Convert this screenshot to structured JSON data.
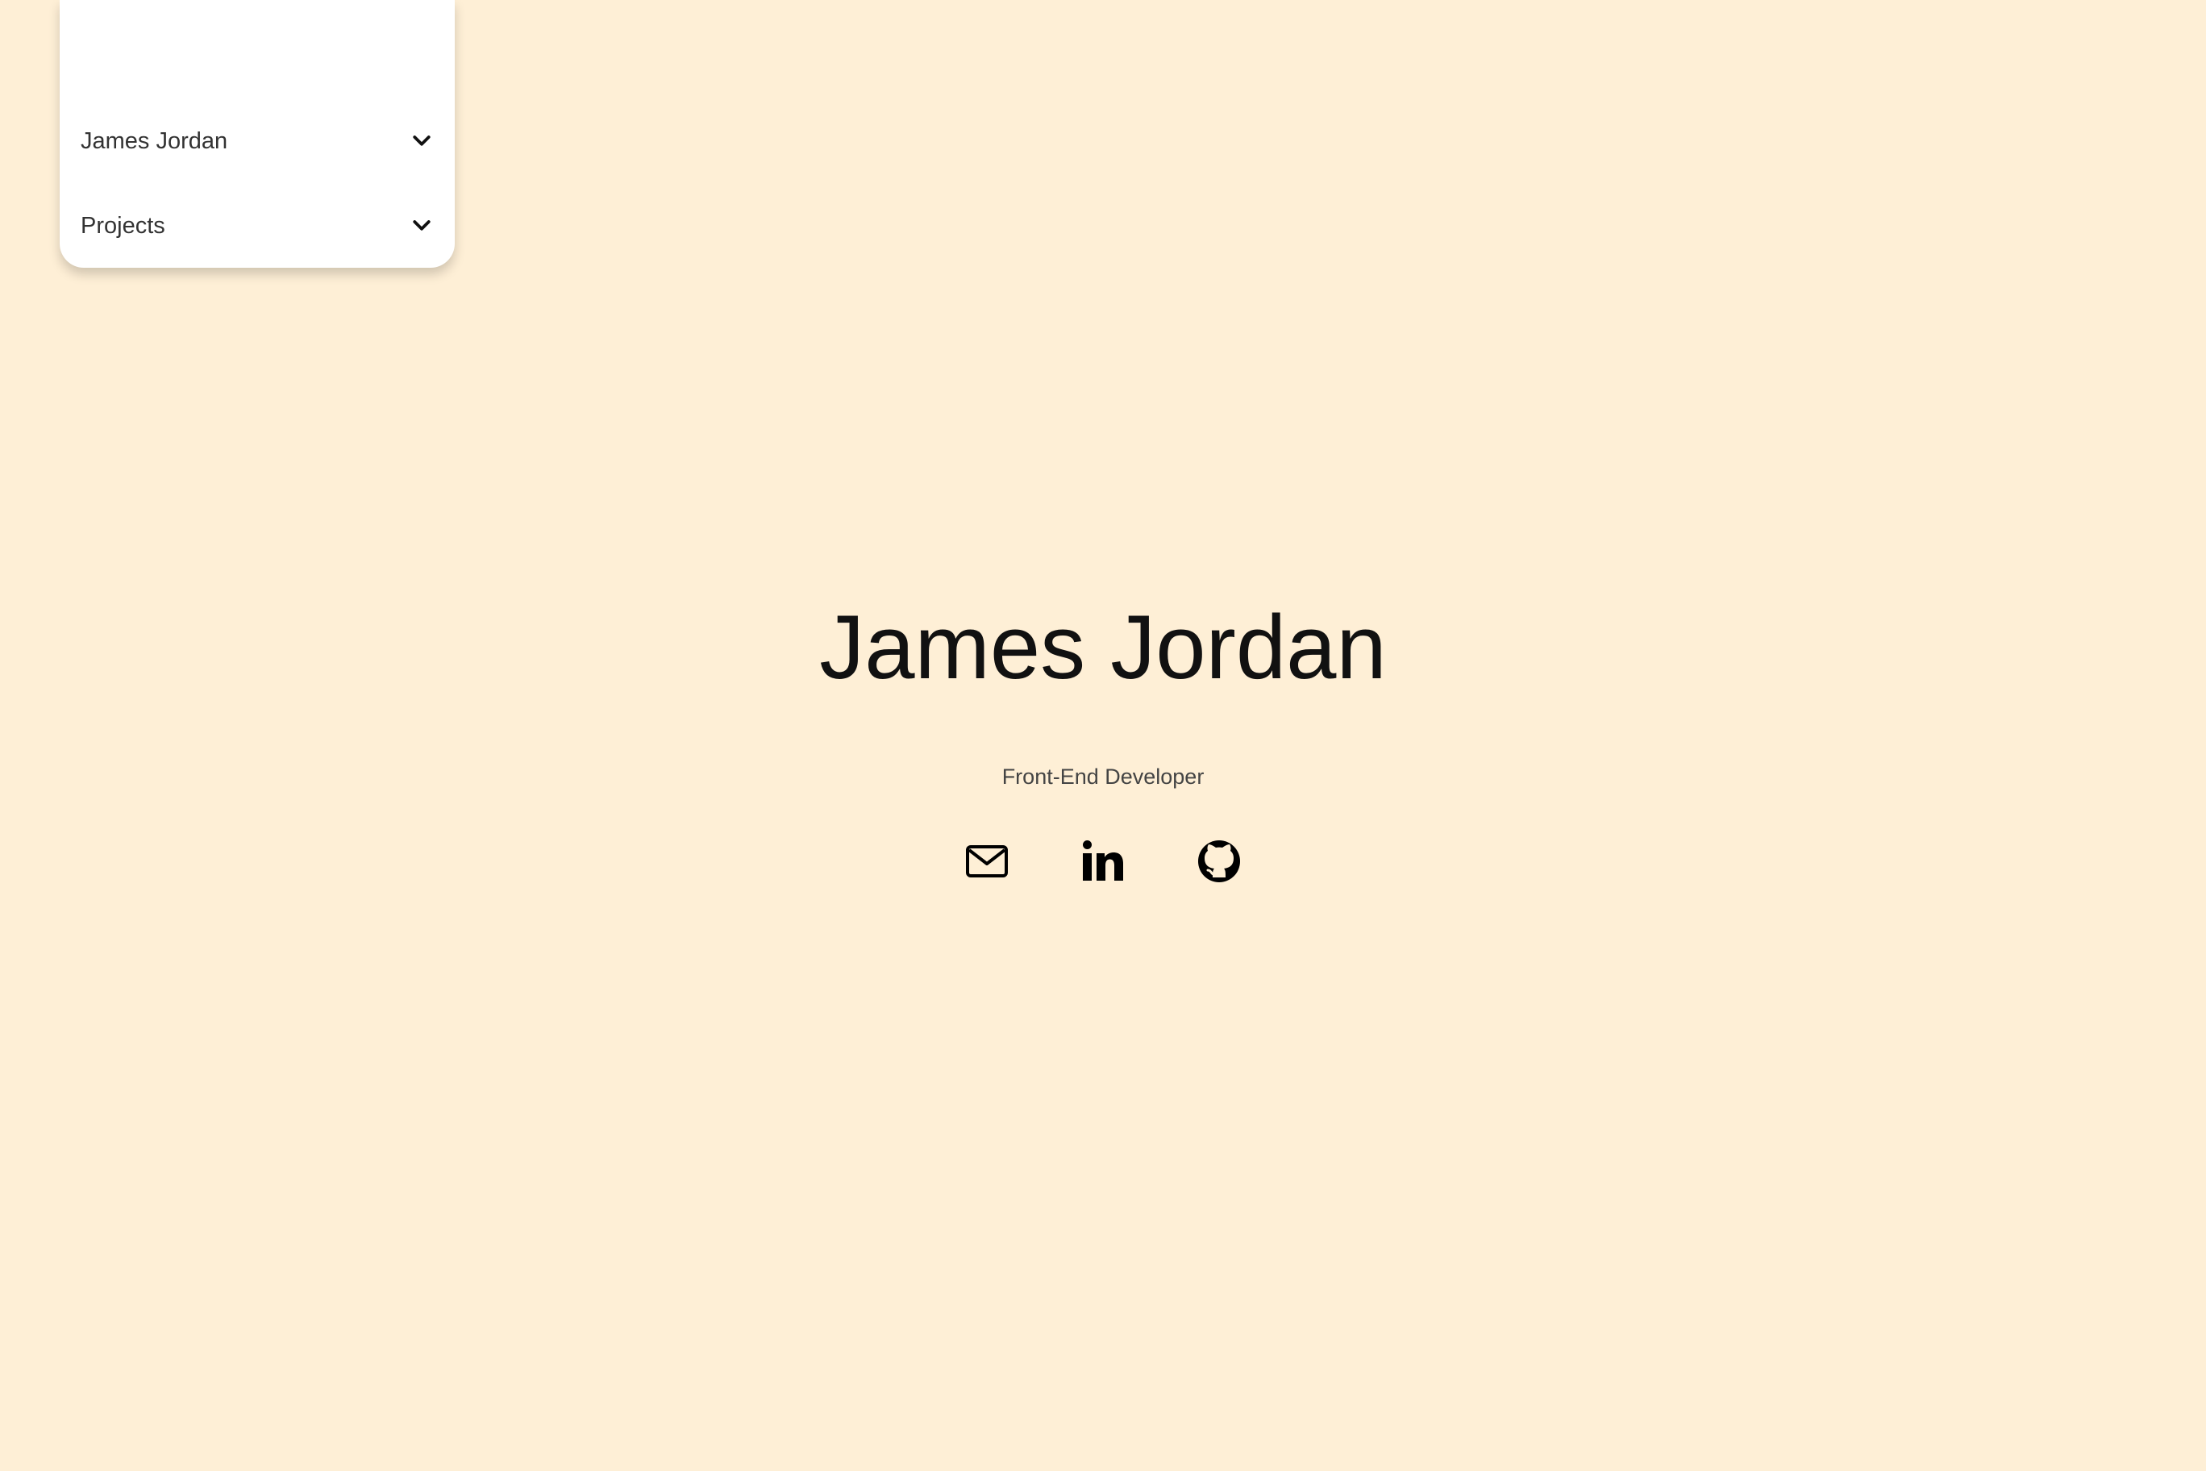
{
  "nav": {
    "items": [
      {
        "label": "James Jordan",
        "icon": "chevron-down-icon"
      },
      {
        "label": "Projects",
        "icon": "chevron-down-icon"
      }
    ]
  },
  "hero": {
    "title": "James Jordan",
    "subtitle": "Front-End Developer",
    "links": [
      {
        "name": "email",
        "icon": "mail-icon"
      },
      {
        "name": "linkedin",
        "icon": "linkedin-icon"
      },
      {
        "name": "github",
        "icon": "github-icon"
      }
    ]
  },
  "colors": {
    "background": "#FEEFD6",
    "panel": "#FFFFFF",
    "text": "#111111"
  }
}
